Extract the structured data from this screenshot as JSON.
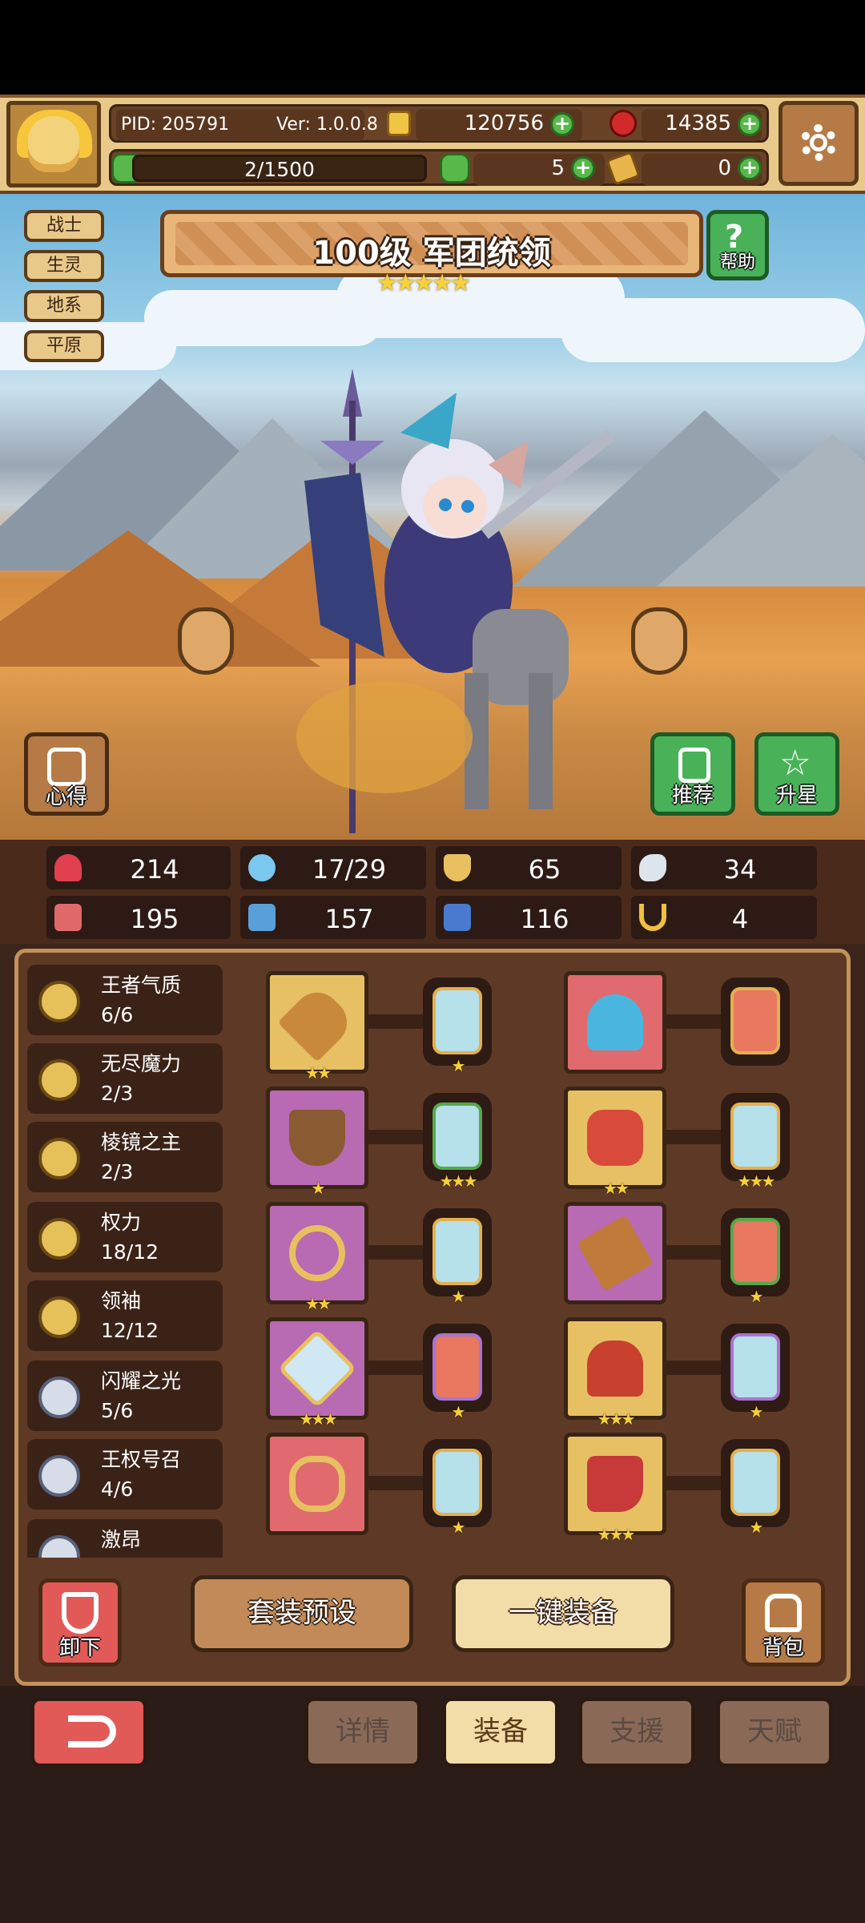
{
  "header": {
    "pid": "PID: 205791",
    "version": "Ver: 1.0.0.8",
    "gold": "120756",
    "gems": "14385",
    "energy": "2/1500",
    "clover": "5",
    "bag_count": "0"
  },
  "side_tags": [
    "战士",
    "生灵",
    "地系",
    "平原"
  ],
  "hero": {
    "title": "100级  军团统领",
    "stars": "★★★★★"
  },
  "scene_buttons": {
    "help": "帮助",
    "notes": "心得",
    "recommend": "推荐",
    "star_up": "升星"
  },
  "stats": [
    {
      "icon": "heart-icon",
      "value": "214",
      "color": "#e04050"
    },
    {
      "icon": "droplet-icon",
      "value": "17/29",
      "color": "#7ac8f0"
    },
    {
      "icon": "shield-icon",
      "value": "65",
      "color": "#e8c060"
    },
    {
      "icon": "wing-icon",
      "value": "34",
      "color": "#dce4ec"
    },
    {
      "icon": "fist-icon",
      "value": "195",
      "color": "#e06a6a"
    },
    {
      "icon": "book-icon",
      "value": "157",
      "color": "#5aa0d8"
    },
    {
      "icon": "boot-icon",
      "value": "116",
      "color": "#4a7ad0"
    },
    {
      "icon": "horseshoe-icon",
      "value": "4",
      "color": "#f0c040"
    }
  ],
  "suits": [
    {
      "name": "王者气质",
      "progress": "6/6",
      "medal": "gold"
    },
    {
      "name": "无尽魔力",
      "progress": "2/3",
      "medal": "gold"
    },
    {
      "name": "棱镜之主",
      "progress": "2/3",
      "medal": "gold"
    },
    {
      "name": "权力",
      "progress": "18/12",
      "medal": "gold"
    },
    {
      "name": "领袖",
      "progress": "12/12",
      "medal": "gold"
    },
    {
      "name": "闪耀之光",
      "progress": "5/6",
      "medal": "silver"
    },
    {
      "name": "王权号召",
      "progress": "4/6",
      "medal": "silver"
    },
    {
      "name": "激昂",
      "progress": "",
      "medal": "silver"
    }
  ],
  "equipment": [
    {
      "slot": "scepter",
      "bg": "gold",
      "stars": "★★",
      "rune_stars": "★",
      "rune": "gold"
    },
    {
      "slot": "helmet",
      "bg": "red",
      "stars": "",
      "rune_stars": "",
      "rune": "red"
    },
    {
      "slot": "wooden-shield",
      "bg": "purple",
      "stars": "★",
      "rune_stars": "★★★",
      "rune": "green"
    },
    {
      "slot": "armor",
      "bg": "gold",
      "stars": "★★",
      "rune_stars": "★★★",
      "rune": "gold"
    },
    {
      "slot": "necklace",
      "bg": "purple",
      "stars": "★★",
      "rune_stars": "★",
      "rune": "gold"
    },
    {
      "slot": "crossbow",
      "bg": "purple",
      "stars": "",
      "rune_stars": "★",
      "rune": "green-red"
    },
    {
      "slot": "crystal",
      "bg": "purple",
      "stars": "★★★",
      "rune_stars": "★",
      "rune": "purple-red"
    },
    {
      "slot": "crown",
      "bg": "gold",
      "stars": "★★★",
      "rune_stars": "★",
      "rune": "purple"
    },
    {
      "slot": "ring",
      "bg": "red",
      "stars": "",
      "rune_stars": "★",
      "rune": "gold"
    },
    {
      "slot": "boots",
      "bg": "gold",
      "stars": "★★★",
      "rune_stars": "★",
      "rune": "gold"
    }
  ],
  "actions": {
    "unequip": "卸下",
    "suit_preset": "套装预设",
    "one_click_equip": "一键装备",
    "backpack": "背包"
  },
  "tabs": [
    "详情",
    "装备",
    "支援",
    "天赋"
  ],
  "active_tab": "装备"
}
